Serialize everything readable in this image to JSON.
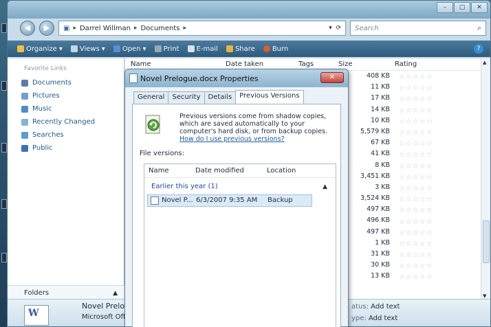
{
  "window": {
    "caption_buttons": [
      "–",
      "▢",
      "✕"
    ]
  },
  "address": {
    "back": "◀",
    "forward": "▶",
    "segments": [
      "Darrel Willman",
      "Documents"
    ],
    "search_placeholder": "Search"
  },
  "toolbar": {
    "items": [
      {
        "label": "Organize",
        "icon": "organize-icon",
        "color": "#f0c040"
      },
      {
        "label": "Views",
        "icon": "views-icon",
        "color": "#c6d6e4"
      },
      {
        "label": "Open",
        "icon": "open-icon",
        "color": "#5a8cd6"
      },
      {
        "label": "Print",
        "icon": "print-icon",
        "color": "#9aa8b4"
      },
      {
        "label": "E-mail",
        "icon": "email-icon",
        "color": "#d8e2ea"
      },
      {
        "label": "Share",
        "icon": "share-icon",
        "color": "#e8b43c"
      },
      {
        "label": "Burn",
        "icon": "burn-icon",
        "color": "#e05a2a"
      }
    ]
  },
  "navpane": {
    "header": "Favorite Links",
    "items": [
      {
        "label": "Documents",
        "icon": "documents-icon",
        "color": "#5a7ab0"
      },
      {
        "label": "Pictures",
        "icon": "pictures-icon",
        "color": "#6fa0cf"
      },
      {
        "label": "Music",
        "icon": "music-icon",
        "color": "#4f8cc7"
      },
      {
        "label": "Recently Changed",
        "icon": "recently-changed-icon",
        "color": "#87b2d8"
      },
      {
        "label": "Searches",
        "icon": "searches-icon",
        "color": "#5d9bd1"
      },
      {
        "label": "Public",
        "icon": "public-icon",
        "color": "#3a73b4"
      }
    ],
    "folders_label": "Folders"
  },
  "filelist": {
    "columns": {
      "name": "Name",
      "date": "Date taken",
      "tags": "Tags",
      "size": "Size",
      "rating": "Rating"
    },
    "sizes": [
      "408 KB",
      "11 KB",
      "17 KB",
      "14 KB",
      "10 KB",
      "5,579 KB",
      "67 KB",
      "41 KB",
      "8 KB",
      "3,451 KB",
      "3 KB",
      "3,524 KB",
      "497 KB",
      "496 KB",
      "497 KB",
      "1 KB",
      "31 KB",
      "30 KB",
      "13 KB"
    ]
  },
  "details": {
    "name": "Novel Prelog",
    "type": "Microsoft Offi",
    "row1_label": "atus:",
    "row1_value": "Add text",
    "row2_label": "ype:",
    "row2_value": "Add text"
  },
  "dialog": {
    "title": "Novel Prelogue.docx Properties",
    "close": "✕",
    "tabs": [
      "General",
      "Security",
      "Details",
      "Previous Versions"
    ],
    "description": "Previous versions come from shadow copies, which are saved automatically to your computer's hard disk, or from backup copies.",
    "link": "How do I use previous versions?",
    "file_versions_label": "File versions:",
    "columns": {
      "name": "Name",
      "date": "Date modified",
      "location": "Location"
    },
    "group": "Earlier this year (1)",
    "row": {
      "name": "Novel P...",
      "date": "6/3/2007 9:35 AM",
      "location": "Backup"
    }
  }
}
